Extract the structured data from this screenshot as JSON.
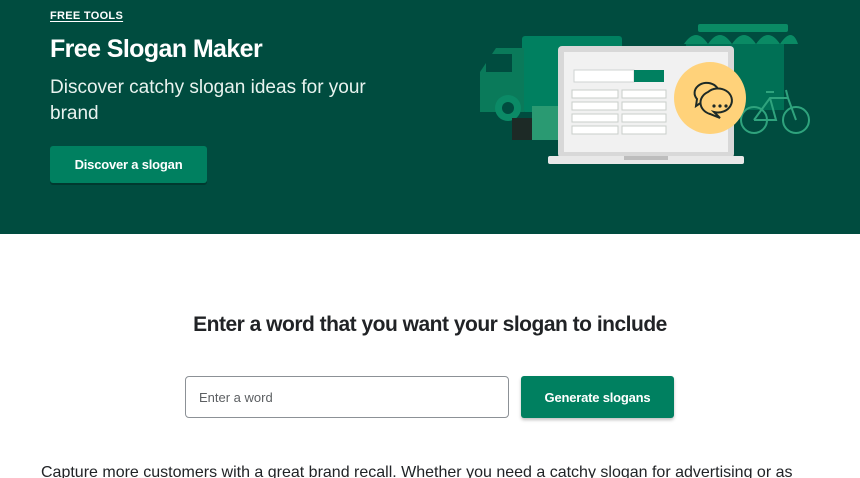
{
  "hero": {
    "eyebrow": "FREE TOOLS",
    "title": "Free Slogan Maker",
    "subtitle": "Discover catchy slogan ideas for your brand",
    "cta_label": "Discover a slogan",
    "background_color": "#004c3f",
    "accent_color": "#008060",
    "illustration_icon": "chat-bubbles-icon"
  },
  "generator": {
    "heading": "Enter a word that you want your slogan to include",
    "input_placeholder": "Enter a word",
    "input_value": "",
    "button_label": "Generate slogans"
  },
  "intro": {
    "text": "Capture more customers with a great brand recall. Whether you need a catchy slogan for advertising or as"
  }
}
